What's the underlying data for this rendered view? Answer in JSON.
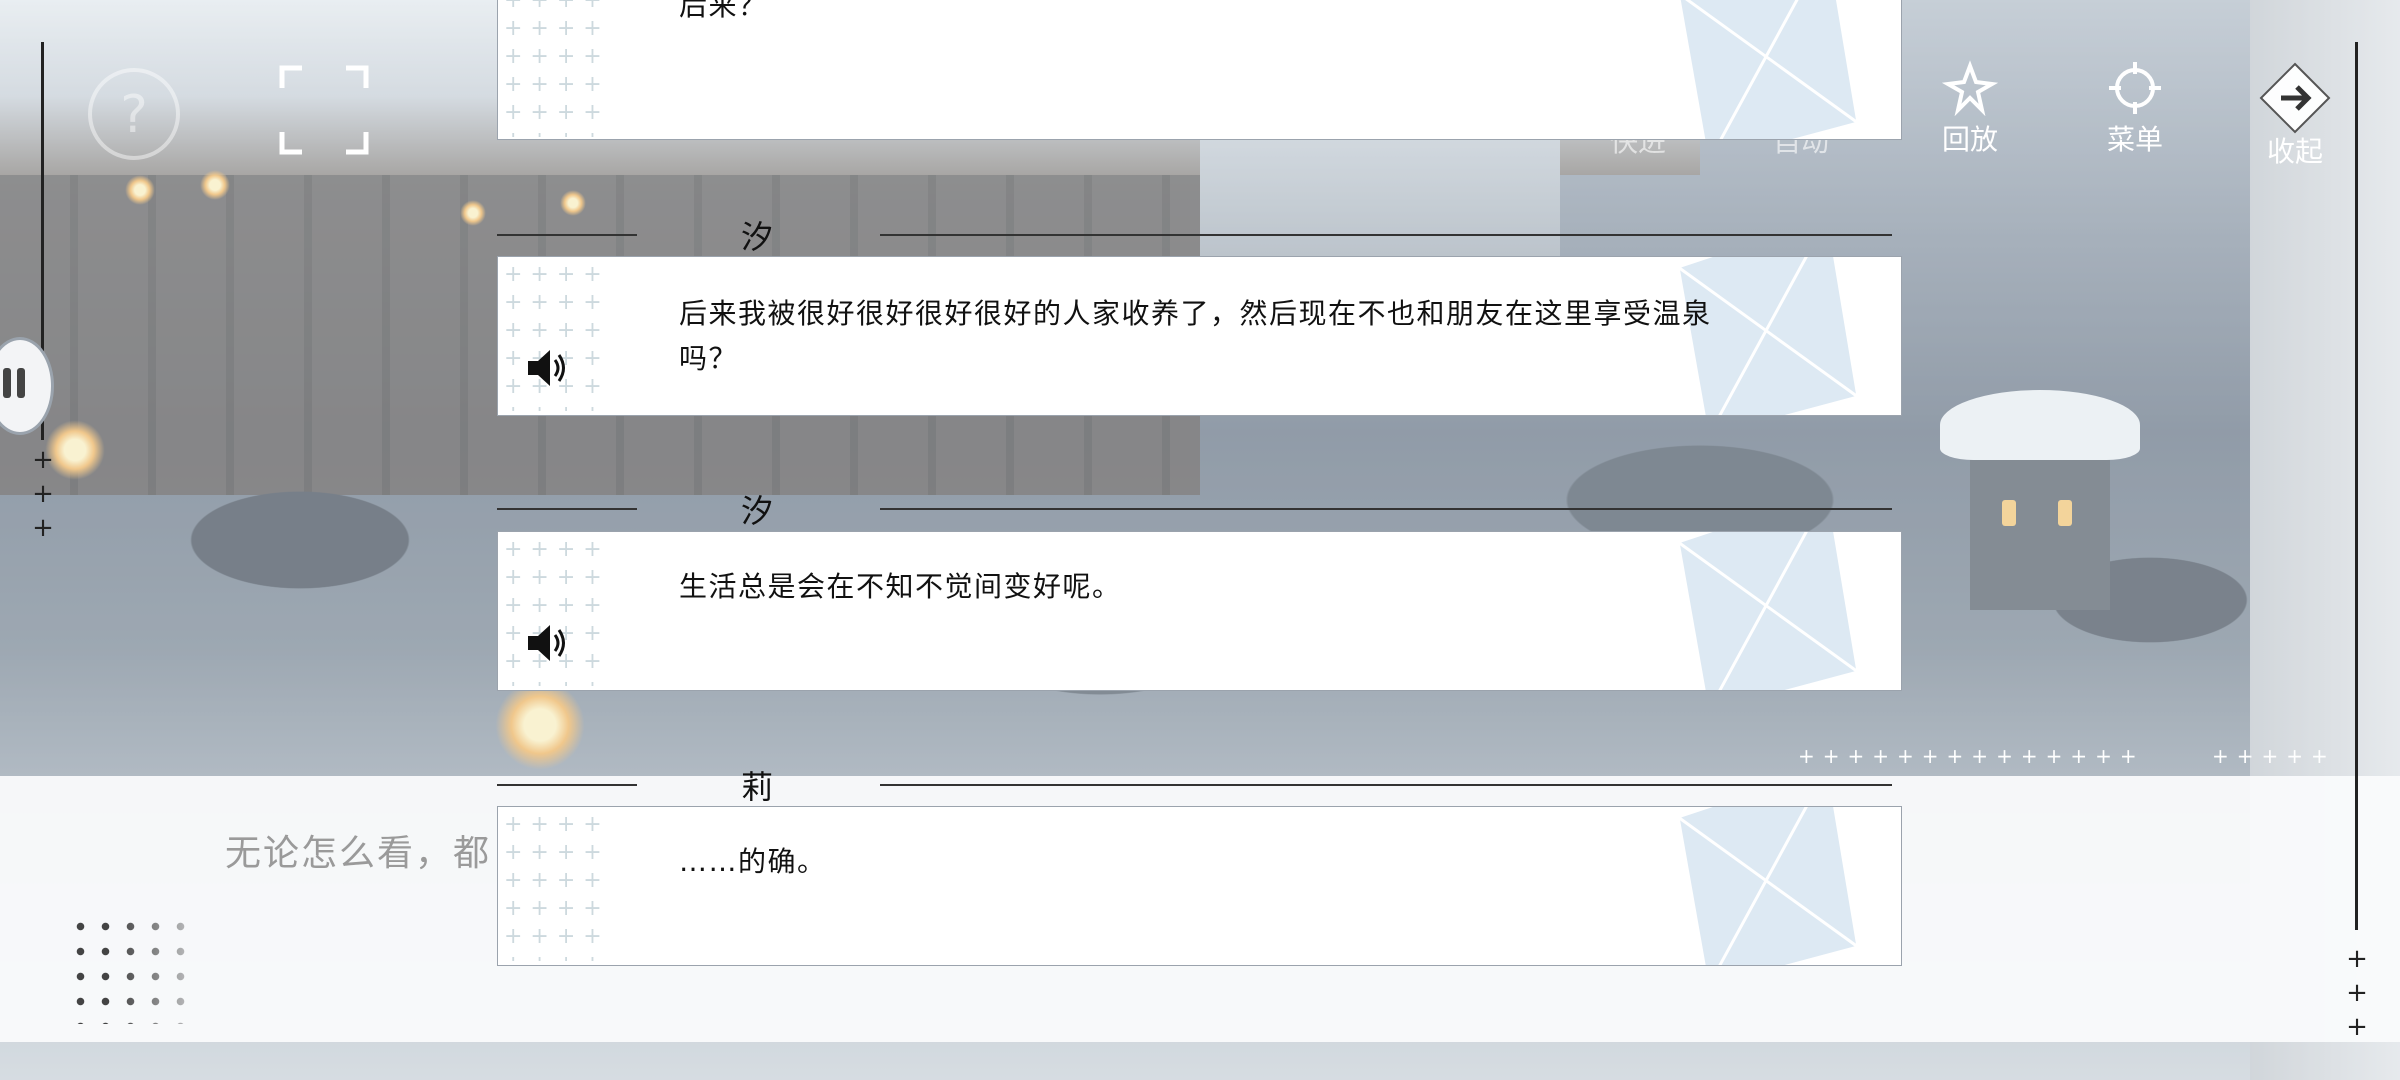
{
  "top_bar": {
    "quick_label": "快进",
    "auto_label": "自动",
    "replay_label": "回放",
    "menu_label": "菜单",
    "collapse_label": "收起"
  },
  "backlog": [
    {
      "speaker": "",
      "text": "后来？",
      "has_voice": false
    },
    {
      "speaker": "汐",
      "text": "后来我被很好很好很好很好的人家收养了，然后现在不也和朋友在这里享受温泉吗？",
      "has_voice": true
    },
    {
      "speaker": "汐",
      "text": "生活总是会在不知不觉间变好呢。",
      "has_voice": true
    },
    {
      "speaker": "莉",
      "text": "……的确。",
      "has_voice": false
    }
  ],
  "textbox": {
    "current_line": "无论怎么看，都"
  },
  "colors": {
    "text": "#111111",
    "rail": "#222222",
    "accent_deco": "#dde9f3"
  }
}
